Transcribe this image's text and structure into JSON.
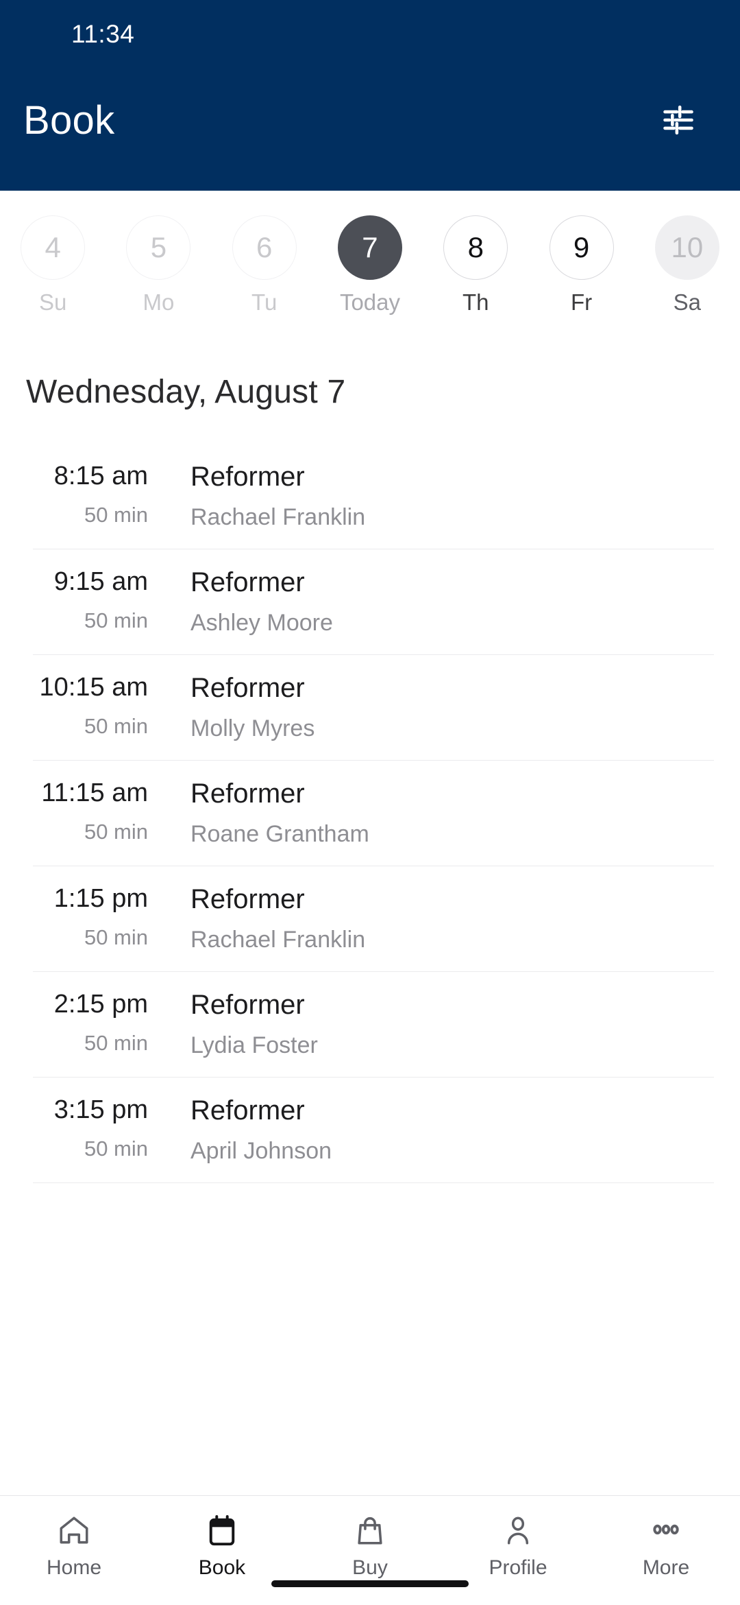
{
  "status_bar": {
    "time": "11:34"
  },
  "app_bar": {
    "title": "Book",
    "filter_icon": "tune-sliders-icon",
    "background_color": "#012f60",
    "text_color": "#ffffff"
  },
  "date_strip": {
    "days": [
      {
        "number": "4",
        "label": "Su",
        "state": "disabled"
      },
      {
        "number": "5",
        "label": "Mo",
        "state": "disabled"
      },
      {
        "number": "6",
        "label": "Tu",
        "state": "disabled"
      },
      {
        "number": "7",
        "label": "Today",
        "state": "selected"
      },
      {
        "number": "8",
        "label": "Th",
        "state": "active"
      },
      {
        "number": "9",
        "label": "Fr",
        "state": "active"
      },
      {
        "number": "10",
        "label": "Sa",
        "state": "filled"
      }
    ],
    "selected_color": "#4c4f56"
  },
  "day_heading": "Wednesday, August 7",
  "classes": [
    {
      "time": "8:15 am",
      "duration": "50 min",
      "name": "Reformer",
      "instructor": "Rachael Franklin"
    },
    {
      "time": "9:15 am",
      "duration": "50 min",
      "name": "Reformer",
      "instructor": "Ashley Moore"
    },
    {
      "time": "10:15 am",
      "duration": "50 min",
      "name": "Reformer",
      "instructor": "Molly Myres"
    },
    {
      "time": "11:15 am",
      "duration": "50 min",
      "name": "Reformer",
      "instructor": "Roane Grantham"
    },
    {
      "time": "1:15 pm",
      "duration": "50 min",
      "name": "Reformer",
      "instructor": "Rachael Franklin"
    },
    {
      "time": "2:15 pm",
      "duration": "50 min",
      "name": "Reformer",
      "instructor": "Lydia Foster"
    },
    {
      "time": "3:15 pm",
      "duration": "50 min",
      "name": "Reformer",
      "instructor": "April Johnson"
    }
  ],
  "bottom_nav": {
    "items": [
      {
        "label": "Home",
        "icon": "home-icon",
        "active": false
      },
      {
        "label": "Book",
        "icon": "calendar-icon",
        "active": true
      },
      {
        "label": "Buy",
        "icon": "bag-icon",
        "active": false
      },
      {
        "label": "Profile",
        "icon": "person-icon",
        "active": false
      },
      {
        "label": "More",
        "icon": "ellipsis-icon",
        "active": false
      }
    ]
  }
}
